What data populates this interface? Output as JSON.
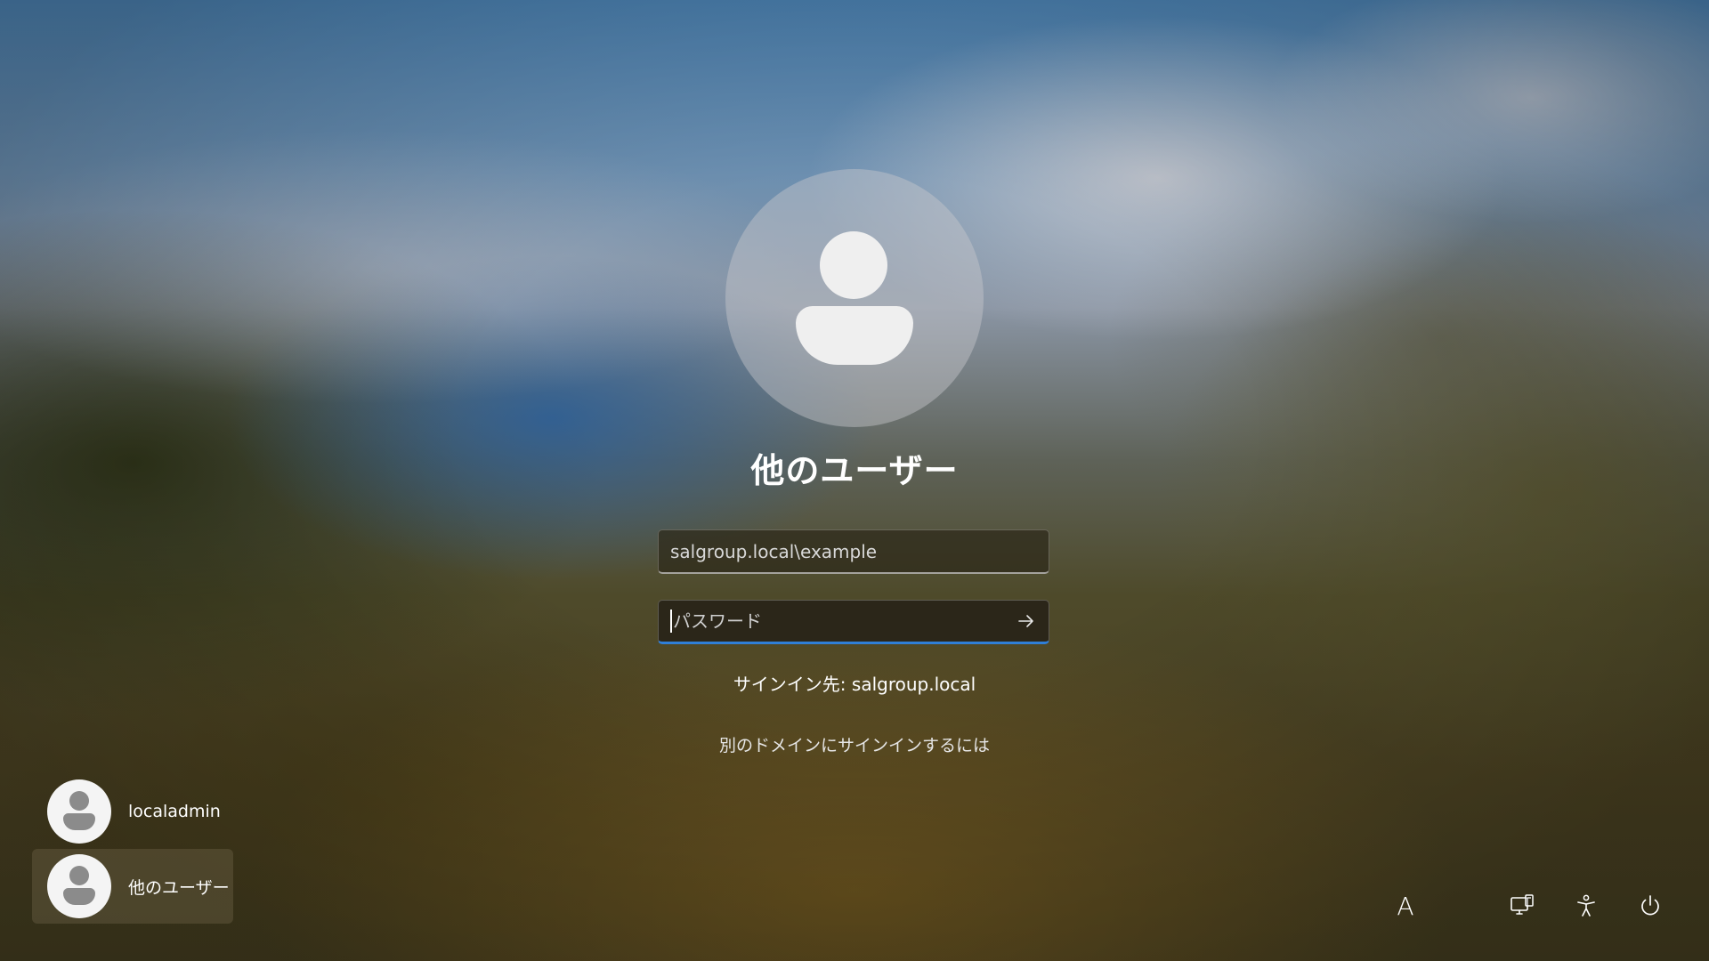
{
  "login": {
    "avatar_icon": "person-icon",
    "user_title": "他のユーザー",
    "username_value": "salgroup.local\\example",
    "password_placeholder": "パスワード",
    "submit_icon": "arrow-right-icon",
    "signin_to": "サインイン先: salgroup.local",
    "other_domain_link": "別のドメインにサインインするには"
  },
  "users": [
    {
      "label": "localadmin",
      "icon": "person-icon",
      "selected": false
    },
    {
      "label": "他のユーザー",
      "icon": "person-icon",
      "selected": true
    }
  ],
  "system_tray": {
    "ime_label": "A",
    "icons": [
      "input-mode-icon",
      "network-icon",
      "accessibility-icon",
      "power-icon"
    ]
  },
  "colors": {
    "focus_accent": "#2f7fd8",
    "text": "#ffffff"
  }
}
